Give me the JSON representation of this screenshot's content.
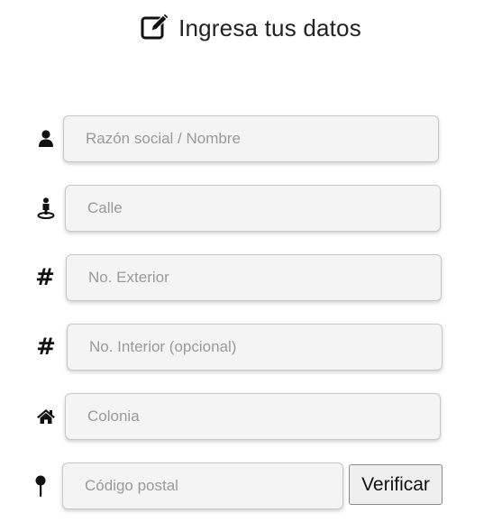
{
  "header": {
    "title": "Ingresa tus datos",
    "icon": "edit-icon"
  },
  "form": {
    "fields": [
      {
        "icon": "user-icon",
        "placeholder": "Razón social / Nombre",
        "value": ""
      },
      {
        "icon": "street-view-icon",
        "placeholder": "Calle",
        "value": ""
      },
      {
        "icon": "hashtag-icon",
        "placeholder": "No. Exterior",
        "value": ""
      },
      {
        "icon": "hashtag-icon",
        "placeholder": "No. Interior (opcional)",
        "value": ""
      },
      {
        "icon": "home-icon",
        "placeholder": "Colonia",
        "value": ""
      },
      {
        "icon": "map-pin-icon",
        "placeholder": "Código postal",
        "value": ""
      }
    ],
    "verify_label": "Verificar"
  },
  "colors": {
    "field_background": "#f4f4f4",
    "field_border": "#c8c8c8",
    "placeholder": "#9a9a9a",
    "icon": "#111111"
  }
}
